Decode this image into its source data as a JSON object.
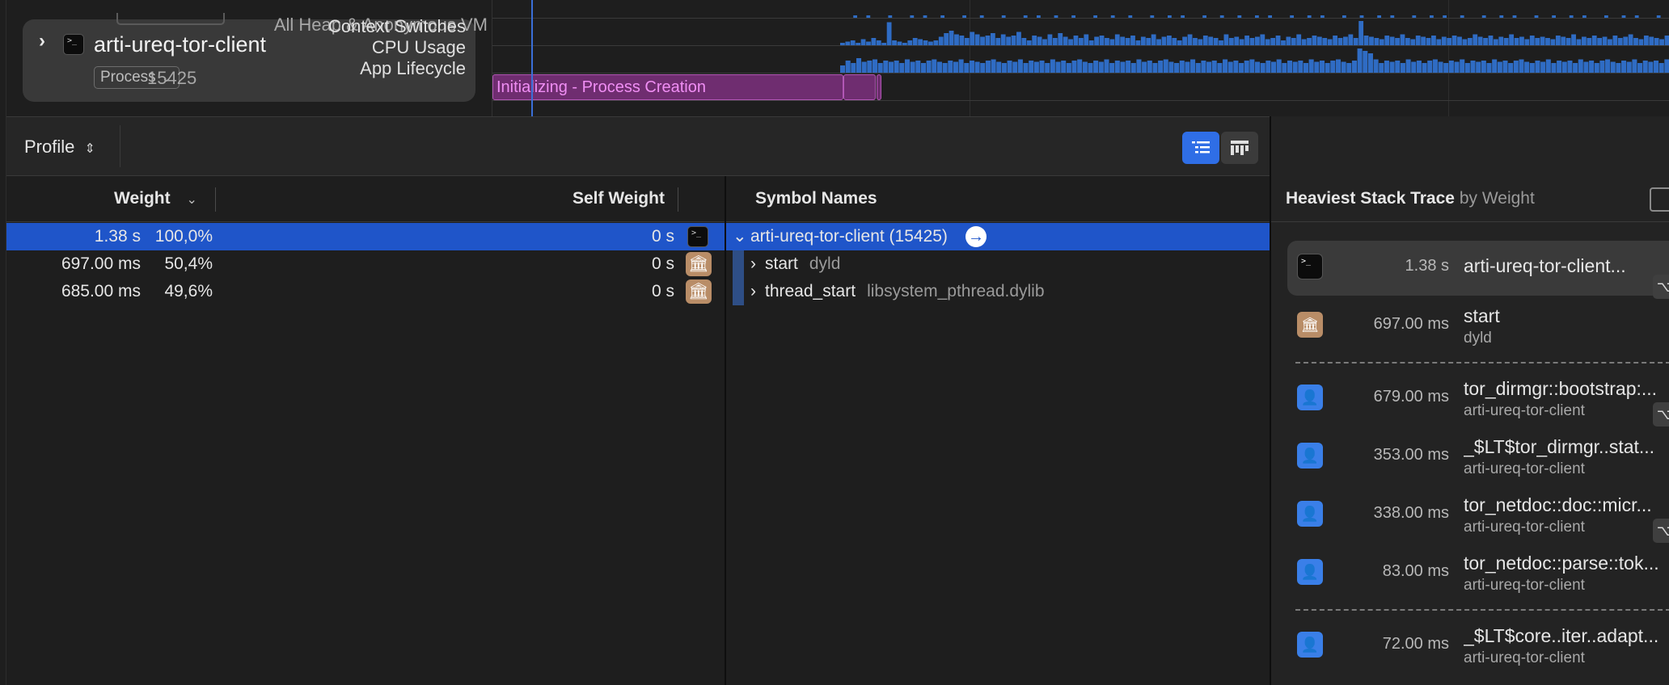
{
  "process": {
    "name": "arti-ureq-tor-client",
    "type_label": "Process",
    "pid": "15425",
    "heap_label": "All Heap & Anonymous VM",
    "tracks": [
      "Context Switches",
      "CPU Usage",
      "App Lifecycle"
    ],
    "lifecycle_segment": "Initializing - Process Creation"
  },
  "toolbar": {
    "profile_label": "Profile"
  },
  "calltree": {
    "headers": {
      "weight": "Weight",
      "self_weight": "Self Weight",
      "symbol_names": "Symbol Names"
    },
    "rows": [
      {
        "weight": "1.38 s",
        "percent": "100,0%",
        "self": "0 s",
        "symbol": "arti-ureq-tor-client (15425)",
        "library": ""
      },
      {
        "weight": "697.00 ms",
        "percent": "50,4%",
        "self": "0 s",
        "symbol": "start",
        "library": "dyld"
      },
      {
        "weight": "685.00 ms",
        "percent": "49,6%",
        "self": "0 s",
        "symbol": "thread_start",
        "library": "libsystem_pthread.dylib"
      }
    ]
  },
  "heaviest": {
    "title": "Heaviest Stack Trace",
    "subtitle": "by Weight",
    "items": [
      {
        "weight": "1.38 s",
        "name": "arti-ureq-tor-client...",
        "library": ""
      },
      {
        "weight": "697.00 ms",
        "name": "start",
        "library": "dyld"
      },
      {
        "weight": "679.00 ms",
        "name": "tor_dirmgr::bootstrap:...",
        "library": "arti-ureq-tor-client"
      },
      {
        "weight": "353.00 ms",
        "name": "_$LT$tor_dirmgr..stat...",
        "library": "arti-ureq-tor-client"
      },
      {
        "weight": "338.00 ms",
        "name": "tor_netdoc::doc::micr...",
        "library": "arti-ureq-tor-client"
      },
      {
        "weight": "83.00 ms",
        "name": "tor_netdoc::parse::tok...",
        "library": "arti-ureq-tor-client"
      },
      {
        "weight": "72.00 ms",
        "name": "_$LT$core..iter..adapt...",
        "library": "arti-ureq-tor-client"
      }
    ]
  },
  "colors": {
    "selection": "#1f55c9",
    "accent": "#2f6ee6",
    "cpu_bar": "#2f6cc4",
    "lifecycle_fill": "#6f2d70",
    "lifecycle_text": "#f08ef4"
  },
  "cpu_activity": {
    "context_switches": [
      0,
      0,
      0,
      1,
      0,
      0,
      1,
      0,
      0,
      0,
      0,
      1,
      0,
      0,
      0,
      0,
      1,
      0,
      0,
      1,
      0,
      0,
      0,
      1,
      0,
      0,
      0,
      0,
      1,
      0,
      0,
      0,
      1,
      0,
      0,
      0,
      0,
      1,
      0,
      0,
      0,
      0,
      1,
      0,
      0,
      1,
      0,
      0,
      0,
      1,
      0,
      0,
      0,
      1,
      0,
      0,
      0,
      0,
      1,
      0,
      0,
      0,
      1,
      0,
      0,
      0,
      1,
      0,
      0,
      0,
      0,
      1,
      0,
      0,
      0,
      1,
      0,
      0,
      1,
      0,
      0,
      0,
      0,
      1,
      0,
      0,
      0,
      1,
      0,
      0,
      0,
      1,
      0,
      0,
      0,
      1,
      0,
      0,
      1,
      0,
      0,
      0,
      0,
      1,
      0,
      0,
      0,
      1,
      0,
      0,
      1,
      0,
      0,
      0,
      0,
      1,
      0,
      0,
      0,
      1,
      0,
      0,
      0,
      1,
      0,
      0,
      1,
      0,
      0,
      0,
      0,
      1,
      0,
      0,
      0,
      1,
      0,
      0,
      1,
      0,
      0,
      0,
      1,
      0,
      0,
      0,
      0,
      1,
      0,
      0,
      0,
      1,
      0,
      0,
      1,
      0,
      0,
      0,
      0,
      1,
      0,
      0,
      0,
      1,
      0,
      0,
      0,
      1,
      0,
      0,
      1,
      0,
      0,
      0,
      0,
      1,
      0,
      0,
      0,
      1,
      0,
      0,
      1,
      0,
      0,
      0,
      0,
      1,
      0,
      0
    ],
    "cpu_usage": [
      0.1,
      0.15,
      0.2,
      0.1,
      0.25,
      0.15,
      0.3,
      0.2,
      0.1,
      0.95,
      0.2,
      0.15,
      0.1,
      0.2,
      0.3,
      0.25,
      0.2,
      0.15,
      0.2,
      0.35,
      0.5,
      0.6,
      0.45,
      0.4,
      0.3,
      0.55,
      0.45,
      0.35,
      0.4,
      0.5,
      0.3,
      0.45,
      0.35,
      0.4,
      0.55,
      0.3,
      0.2,
      0.4,
      0.35,
      0.25,
      0.45,
      0.3,
      0.5,
      0.35,
      0.25,
      0.4,
      0.3,
      0.45,
      0.2,
      0.35,
      0.4,
      0.3,
      0.25,
      0.45,
      0.35,
      0.3,
      0.4,
      0.2,
      0.35,
      0.3,
      0.45,
      0.25,
      0.35,
      0.4,
      0.3,
      0.2,
      0.35,
      0.45,
      0.3,
      0.25,
      0.4,
      0.35,
      0.3,
      0.2,
      0.45,
      0.3,
      0.35,
      0.25,
      0.4,
      0.3,
      0.35,
      0.45,
      0.25,
      0.3,
      0.4,
      0.2,
      0.35,
      0.3,
      0.45,
      0.25,
      0.3,
      0.4,
      0.35,
      0.3,
      0.25,
      0.4,
      0.3,
      0.35,
      0.45,
      0.3,
      1.0,
      0.4,
      0.35,
      0.3,
      0.25,
      0.4,
      0.35,
      0.3,
      0.45,
      0.3,
      0.25,
      0.4,
      0.35,
      0.3,
      0.4,
      0.25,
      0.35,
      0.3,
      0.4,
      0.35,
      0.25,
      0.3,
      0.45,
      0.35,
      0.3,
      0.4,
      0.25,
      0.35,
      0.3,
      0.45,
      0.3,
      0.35,
      0.25,
      0.4,
      0.3,
      0.35,
      0.3,
      0.25,
      0.4,
      0.35,
      0.3,
      0.45,
      0.25,
      0.35,
      0.3,
      0.4,
      0.3,
      0.35,
      0.25,
      0.4,
      0.3,
      0.35,
      0.45,
      0.3,
      0.25,
      0.4,
      0.35,
      0.3,
      0.25,
      0.4
    ],
    "app_lifecycle": [
      0.3,
      0.5,
      0.4,
      0.6,
      0.45,
      0.5,
      0.55,
      0.4,
      0.5,
      0.45,
      0.5,
      0.4,
      0.55,
      0.45,
      0.5,
      0.4,
      0.5,
      0.55,
      0.45,
      0.4,
      0.5,
      0.45,
      0.55,
      0.4,
      0.5,
      0.45,
      0.4,
      0.5,
      0.55,
      0.45,
      0.4,
      0.5,
      0.45,
      0.55,
      0.4,
      0.5,
      0.45,
      0.5,
      0.4,
      0.55,
      0.45,
      0.5,
      0.4,
      0.5,
      0.55,
      0.45,
      0.4,
      0.5,
      0.45,
      0.55,
      0.4,
      0.5,
      0.45,
      0.5,
      0.4,
      0.55,
      0.45,
      0.5,
      0.4,
      0.5,
      0.55,
      0.45,
      0.4,
      0.5,
      0.45,
      0.55,
      0.4,
      0.5,
      0.45,
      0.5,
      0.4,
      0.55,
      0.45,
      0.5,
      0.4,
      0.5,
      0.55,
      0.45,
      0.4,
      0.5,
      0.45,
      0.55,
      0.4,
      0.5,
      0.45,
      0.5,
      0.4,
      0.55,
      0.45,
      0.5,
      0.4,
      0.5,
      0.55,
      0.45,
      0.4,
      0.5,
      1.0,
      0.9,
      0.8,
      0.55,
      0.4,
      0.5,
      0.45,
      0.5,
      0.4,
      0.55,
      0.45,
      0.5,
      0.4,
      0.5,
      0.55,
      0.45,
      0.4,
      0.5,
      0.45,
      0.55,
      0.4,
      0.5,
      0.45,
      0.5,
      0.4,
      0.55,
      0.45,
      0.5,
      0.4,
      0.5,
      0.55,
      0.45,
      0.4,
      0.5,
      0.45,
      0.55,
      0.4,
      0.5,
      0.45,
      0.5,
      0.4,
      0.55,
      0.45,
      0.5,
      0.4,
      0.5,
      0.55,
      0.45,
      0.4,
      0.5,
      0.45,
      0.55,
      0.4,
      0.5,
      0.45,
      0.5,
      0.4,
      0.55
    ]
  }
}
